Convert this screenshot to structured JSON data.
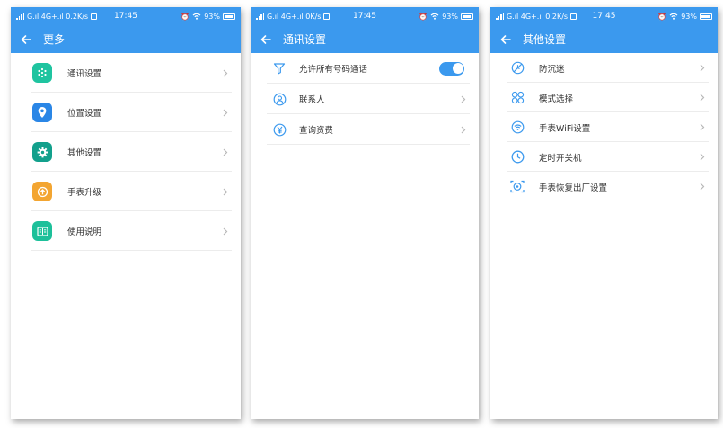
{
  "colors": {
    "header": "#3b99ee",
    "chevron": "#b8b8b8",
    "icon_blue": "#3b99ee"
  },
  "screens": [
    {
      "status": {
        "left_text": "G.ıl 4G+.ıl 0.2K/s",
        "time": "17:45",
        "battery": "93%"
      },
      "title": "更多",
      "items": [
        {
          "label": "通讯设置",
          "icon": "dots-circle-icon",
          "color": "#1fc4a0"
        },
        {
          "label": "位置设置",
          "icon": "location-pin-icon",
          "color": "#2a86e6"
        },
        {
          "label": "其他设置",
          "icon": "gear-icon",
          "color": "#12a08c"
        },
        {
          "label": "手表升级",
          "icon": "upgrade-icon",
          "color": "#f3a531"
        },
        {
          "label": "使用说明",
          "icon": "manual-icon",
          "color": "#1dc09a"
        }
      ]
    },
    {
      "status": {
        "left_text": "G.ıl 4G+.ıl 0K/s",
        "time": "17:45",
        "battery": "93%"
      },
      "title": "通讯设置",
      "items": [
        {
          "label": "允许所有号码通话",
          "icon": "filter-icon"
        },
        {
          "label": "联系人",
          "icon": "contact-icon"
        },
        {
          "label": "查询资费",
          "icon": "yen-icon"
        }
      ]
    },
    {
      "status": {
        "left_text": "G.ıl 4G+.ıl 0.2K/s",
        "time": "17:45",
        "battery": "93%"
      },
      "title": "其他设置",
      "items": [
        {
          "label": "防沉迷",
          "icon": "no-disturb-icon"
        },
        {
          "label": "模式选择",
          "icon": "mode-icon"
        },
        {
          "label": "手表WiFi设置",
          "icon": "wifi-icon"
        },
        {
          "label": "定时开关机",
          "icon": "clock-icon"
        },
        {
          "label": "手表恢复出厂设置",
          "icon": "factory-reset-icon"
        }
      ]
    }
  ]
}
